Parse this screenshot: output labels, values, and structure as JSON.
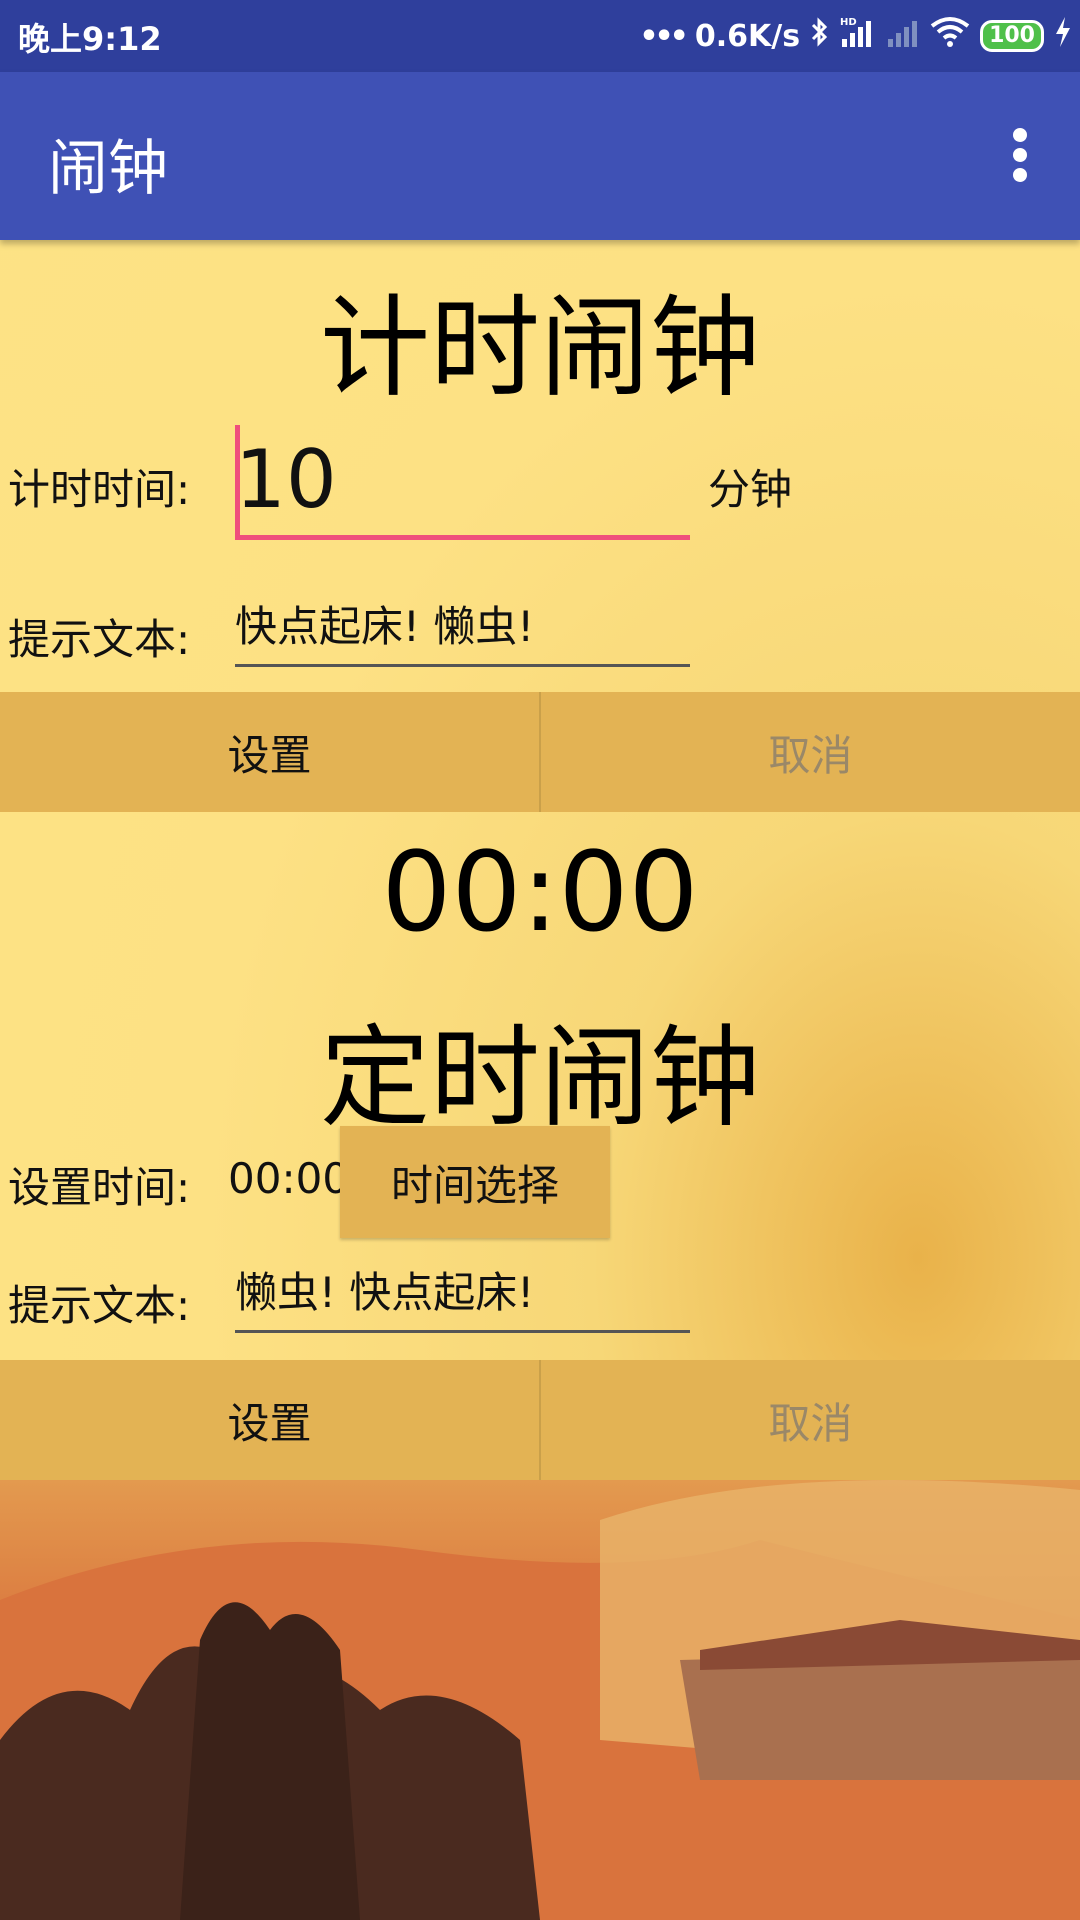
{
  "status_bar": {
    "time": "晚上9:12",
    "network_speed": "0.6K/s",
    "battery": "100",
    "icons": [
      "more-dots-icon",
      "bluetooth-icon",
      "hd-signal-icon",
      "signal-icon",
      "wifi-icon",
      "battery-icon",
      "charging-icon"
    ]
  },
  "app_bar": {
    "title": "闹钟"
  },
  "timer_section": {
    "title": "计时闹钟",
    "time_label": "计时时间:",
    "time_value": "10",
    "unit": "分钟",
    "text_label": "提示文本:",
    "text_value": "快点起床! 懒虫!",
    "set_button": "设置",
    "cancel_button": "取消",
    "countdown": "00:00"
  },
  "alarm_section": {
    "title": "定时闹钟",
    "time_label": "设置时间:",
    "time_value": "00:00",
    "pick_button": "时间选择",
    "text_label": "提示文本:",
    "text_value": "懒虫! 快点起床!",
    "set_button": "设置",
    "cancel_button": "取消"
  },
  "colors": {
    "status_bar": "#2f3f9c",
    "app_bar": "#3f51b5",
    "button": "#e3b354",
    "accent": "#ef4f7c",
    "background": "#fde385"
  }
}
